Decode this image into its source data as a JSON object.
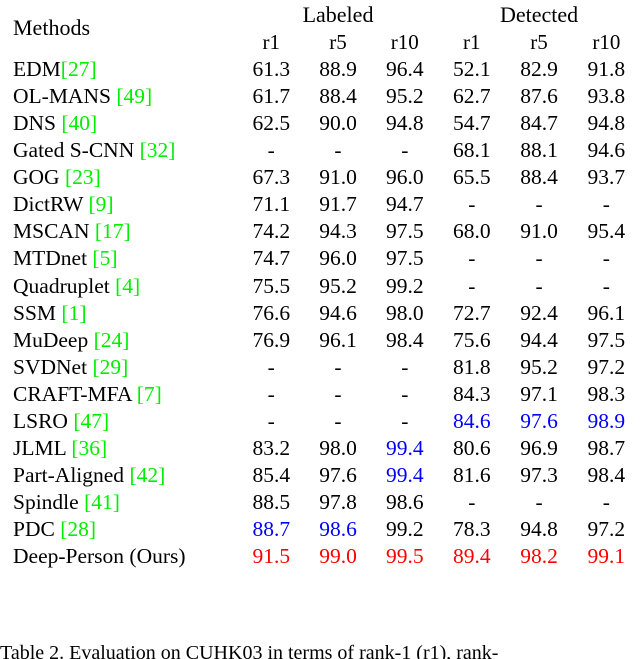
{
  "table": {
    "header": {
      "methods_label": "Methods",
      "groups": [
        {
          "label": "Labeled"
        },
        {
          "label": "Detected"
        }
      ],
      "ranks": [
        "r1",
        "r5",
        "r10",
        "r1",
        "r5",
        "r10"
      ]
    },
    "colors": {
      "reference": "#00ee00",
      "second_best": "#0000ff",
      "ours": "#ff0000",
      "text": "#000000",
      "rule": "#000000"
    },
    "rows": [
      {
        "name": "EDM",
        "ref": "[27]",
        "space_before_ref": false,
        "values": [
          {
            "text": "61.3",
            "style": "plain"
          },
          {
            "text": "88.9",
            "style": "plain"
          },
          {
            "text": "96.4",
            "style": "plain"
          },
          {
            "text": "52.1",
            "style": "plain"
          },
          {
            "text": "82.9",
            "style": "plain"
          },
          {
            "text": "91.8",
            "style": "plain"
          }
        ]
      },
      {
        "name": "OL-MANS",
        "ref": "[49]",
        "space_before_ref": true,
        "values": [
          {
            "text": "61.7",
            "style": "plain"
          },
          {
            "text": "88.4",
            "style": "plain"
          },
          {
            "text": "95.2",
            "style": "plain"
          },
          {
            "text": "62.7",
            "style": "plain"
          },
          {
            "text": "87.6",
            "style": "plain"
          },
          {
            "text": "93.8",
            "style": "plain"
          }
        ]
      },
      {
        "name": "DNS",
        "ref": "[40]",
        "space_before_ref": true,
        "values": [
          {
            "text": "62.5",
            "style": "plain"
          },
          {
            "text": "90.0",
            "style": "plain"
          },
          {
            "text": "94.8",
            "style": "plain"
          },
          {
            "text": "54.7",
            "style": "plain"
          },
          {
            "text": "84.7",
            "style": "plain"
          },
          {
            "text": "94.8",
            "style": "plain"
          }
        ]
      },
      {
        "name": "Gated S-CNN",
        "ref": "[32]",
        "space_before_ref": true,
        "values": [
          {
            "text": "-",
            "style": "plain"
          },
          {
            "text": "-",
            "style": "plain"
          },
          {
            "text": "-",
            "style": "plain"
          },
          {
            "text": "68.1",
            "style": "plain"
          },
          {
            "text": "88.1",
            "style": "plain"
          },
          {
            "text": "94.6",
            "style": "plain"
          }
        ]
      },
      {
        "name": "GOG",
        "ref": "[23]",
        "space_before_ref": true,
        "values": [
          {
            "text": "67.3",
            "style": "plain"
          },
          {
            "text": "91.0",
            "style": "plain"
          },
          {
            "text": "96.0",
            "style": "plain"
          },
          {
            "text": "65.5",
            "style": "plain"
          },
          {
            "text": "88.4",
            "style": "plain"
          },
          {
            "text": "93.7",
            "style": "plain"
          }
        ]
      },
      {
        "name": "DictRW",
        "ref": "[9]",
        "space_before_ref": true,
        "values": [
          {
            "text": "71.1",
            "style": "plain"
          },
          {
            "text": "91.7",
            "style": "plain"
          },
          {
            "text": "94.7",
            "style": "plain"
          },
          {
            "text": "-",
            "style": "plain"
          },
          {
            "text": "-",
            "style": "plain"
          },
          {
            "text": "-",
            "style": "plain"
          }
        ]
      },
      {
        "name": "MSCAN",
        "ref": "[17]",
        "space_before_ref": true,
        "values": [
          {
            "text": "74.2",
            "style": "plain"
          },
          {
            "text": "94.3",
            "style": "plain"
          },
          {
            "text": "97.5",
            "style": "plain"
          },
          {
            "text": "68.0",
            "style": "plain"
          },
          {
            "text": "91.0",
            "style": "plain"
          },
          {
            "text": "95.4",
            "style": "plain"
          }
        ]
      },
      {
        "name": "MTDnet",
        "ref": "[5]",
        "space_before_ref": true,
        "values": [
          {
            "text": "74.7",
            "style": "plain"
          },
          {
            "text": "96.0",
            "style": "plain"
          },
          {
            "text": "97.5",
            "style": "plain"
          },
          {
            "text": "-",
            "style": "plain"
          },
          {
            "text": "-",
            "style": "plain"
          },
          {
            "text": "-",
            "style": "plain"
          }
        ]
      },
      {
        "name": "Quadruplet",
        "ref": "[4]",
        "space_before_ref": true,
        "values": [
          {
            "text": "75.5",
            "style": "plain"
          },
          {
            "text": "95.2",
            "style": "plain"
          },
          {
            "text": "99.2",
            "style": "plain"
          },
          {
            "text": "-",
            "style": "plain"
          },
          {
            "text": "-",
            "style": "plain"
          },
          {
            "text": "-",
            "style": "plain"
          }
        ]
      },
      {
        "name": "SSM",
        "ref": "[1]",
        "space_before_ref": true,
        "values": [
          {
            "text": "76.6",
            "style": "plain"
          },
          {
            "text": "94.6",
            "style": "plain"
          },
          {
            "text": "98.0",
            "style": "plain"
          },
          {
            "text": "72.7",
            "style": "plain"
          },
          {
            "text": "92.4",
            "style": "plain"
          },
          {
            "text": "96.1",
            "style": "plain"
          }
        ]
      },
      {
        "name": "MuDeep",
        "ref": "[24]",
        "space_before_ref": true,
        "values": [
          {
            "text": "76.9",
            "style": "plain"
          },
          {
            "text": "96.1",
            "style": "plain"
          },
          {
            "text": "98.4",
            "style": "plain"
          },
          {
            "text": "75.6",
            "style": "plain"
          },
          {
            "text": "94.4",
            "style": "plain"
          },
          {
            "text": "97.5",
            "style": "plain"
          }
        ]
      },
      {
        "name": "SVDNet",
        "ref": "[29]",
        "space_before_ref": true,
        "values": [
          {
            "text": "-",
            "style": "plain"
          },
          {
            "text": "-",
            "style": "plain"
          },
          {
            "text": "-",
            "style": "plain"
          },
          {
            "text": "81.8",
            "style": "plain"
          },
          {
            "text": "95.2",
            "style": "plain"
          },
          {
            "text": "97.2",
            "style": "plain"
          }
        ]
      },
      {
        "name": "CRAFT-MFA",
        "ref": "[7]",
        "space_before_ref": true,
        "values": [
          {
            "text": "-",
            "style": "plain"
          },
          {
            "text": "-",
            "style": "plain"
          },
          {
            "text": "-",
            "style": "plain"
          },
          {
            "text": "84.3",
            "style": "plain"
          },
          {
            "text": "97.1",
            "style": "plain"
          },
          {
            "text": "98.3",
            "style": "plain"
          }
        ]
      },
      {
        "name": "LSRO",
        "ref": "[47]",
        "space_before_ref": true,
        "values": [
          {
            "text": "-",
            "style": "plain"
          },
          {
            "text": "-",
            "style": "plain"
          },
          {
            "text": "-",
            "style": "plain"
          },
          {
            "text": "84.6",
            "style": "blue"
          },
          {
            "text": "97.6",
            "style": "blue"
          },
          {
            "text": "98.9",
            "style": "blue"
          }
        ]
      },
      {
        "name": "JLML",
        "ref": "[36]",
        "space_before_ref": true,
        "values": [
          {
            "text": "83.2",
            "style": "plain"
          },
          {
            "text": "98.0",
            "style": "plain"
          },
          {
            "text": "99.4",
            "style": "blue"
          },
          {
            "text": "80.6",
            "style": "plain"
          },
          {
            "text": "96.9",
            "style": "plain"
          },
          {
            "text": "98.7",
            "style": "plain"
          }
        ]
      },
      {
        "name": "Part-Aligned",
        "ref": "[42]",
        "space_before_ref": true,
        "values": [
          {
            "text": "85.4",
            "style": "plain"
          },
          {
            "text": "97.6",
            "style": "plain"
          },
          {
            "text": "99.4",
            "style": "blue"
          },
          {
            "text": "81.6",
            "style": "plain"
          },
          {
            "text": "97.3",
            "style": "plain"
          },
          {
            "text": "98.4",
            "style": "plain"
          }
        ]
      },
      {
        "name": "Spindle",
        "ref": "[41]",
        "space_before_ref": true,
        "values": [
          {
            "text": "88.5",
            "style": "plain"
          },
          {
            "text": "97.8",
            "style": "plain"
          },
          {
            "text": "98.6",
            "style": "plain"
          },
          {
            "text": "-",
            "style": "plain"
          },
          {
            "text": "-",
            "style": "plain"
          },
          {
            "text": "-",
            "style": "plain"
          }
        ]
      },
      {
        "name": "PDC",
        "ref": "[28]",
        "space_before_ref": true,
        "values": [
          {
            "text": "88.7",
            "style": "blue"
          },
          {
            "text": "98.6",
            "style": "blue"
          },
          {
            "text": "99.2",
            "style": "plain"
          },
          {
            "text": "78.3",
            "style": "plain"
          },
          {
            "text": "94.8",
            "style": "plain"
          },
          {
            "text": "97.2",
            "style": "plain"
          }
        ]
      }
    ],
    "ours_row": {
      "label": "Deep-Person (Ours)",
      "values": [
        {
          "text": "91.5",
          "style": "red"
        },
        {
          "text": "99.0",
          "style": "red"
        },
        {
          "text": "99.5",
          "style": "red"
        },
        {
          "text": "89.4",
          "style": "red"
        },
        {
          "text": "98.2",
          "style": "red"
        },
        {
          "text": "99.1",
          "style": "red"
        }
      ]
    }
  },
  "caption": {
    "text": "Table 2. Evaluation on CUHK03 in terms of rank-1 (r1), rank-"
  },
  "chart_data": {
    "type": "table",
    "title": "Table 2. Evaluation on CUHK03 in terms of rank-1 (r1), rank-",
    "column_groups": [
      "Labeled",
      "Detected"
    ],
    "columns": [
      "Methods",
      "Labeled r1",
      "Labeled r5",
      "Labeled r10",
      "Detected r1",
      "Detected r5",
      "Detected r10"
    ],
    "rows": [
      [
        "EDM[27]",
        61.3,
        88.9,
        96.4,
        52.1,
        82.9,
        91.8
      ],
      [
        "OL-MANS [49]",
        61.7,
        88.4,
        95.2,
        62.7,
        87.6,
        93.8
      ],
      [
        "DNS [40]",
        62.5,
        90.0,
        94.8,
        54.7,
        84.7,
        94.8
      ],
      [
        "Gated S-CNN [32]",
        null,
        null,
        null,
        68.1,
        88.1,
        94.6
      ],
      [
        "GOG [23]",
        67.3,
        91.0,
        96.0,
        65.5,
        88.4,
        93.7
      ],
      [
        "DictRW [9]",
        71.1,
        91.7,
        94.7,
        null,
        null,
        null
      ],
      [
        "MSCAN [17]",
        74.2,
        94.3,
        97.5,
        68.0,
        91.0,
        95.4
      ],
      [
        "MTDnet [5]",
        74.7,
        96.0,
        97.5,
        null,
        null,
        null
      ],
      [
        "Quadruplet [4]",
        75.5,
        95.2,
        99.2,
        null,
        null,
        null
      ],
      [
        "SSM [1]",
        76.6,
        94.6,
        98.0,
        72.7,
        92.4,
        96.1
      ],
      [
        "MuDeep [24]",
        76.9,
        96.1,
        98.4,
        75.6,
        94.4,
        97.5
      ],
      [
        "SVDNet [29]",
        null,
        null,
        null,
        81.8,
        95.2,
        97.2
      ],
      [
        "CRAFT-MFA [7]",
        null,
        null,
        null,
        84.3,
        97.1,
        98.3
      ],
      [
        "LSRO [47]",
        null,
        null,
        null,
        84.6,
        97.6,
        98.9
      ],
      [
        "JLML [36]",
        83.2,
        98.0,
        99.4,
        80.6,
        96.9,
        98.7
      ],
      [
        "Part-Aligned [42]",
        85.4,
        97.6,
        99.4,
        81.6,
        97.3,
        98.4
      ],
      [
        "Spindle [41]",
        88.5,
        97.8,
        98.6,
        null,
        null,
        null
      ],
      [
        "PDC [28]",
        88.7,
        98.6,
        99.2,
        78.3,
        94.8,
        97.2
      ],
      [
        "Deep-Person (Ours)",
        91.5,
        99.0,
        99.5,
        89.4,
        98.2,
        99.1
      ]
    ]
  }
}
